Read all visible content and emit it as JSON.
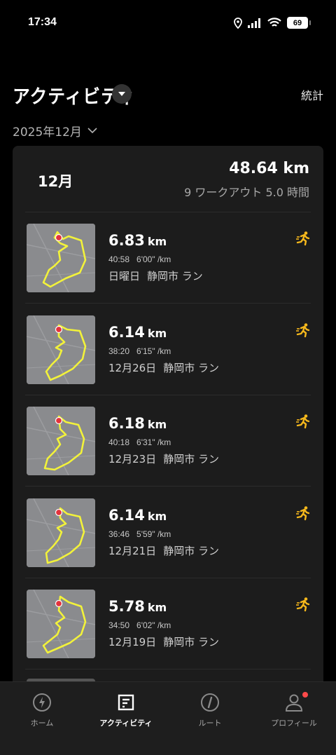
{
  "status_bar": {
    "time": "17:34",
    "battery": "69",
    "icons": [
      "location-icon",
      "signal-icon",
      "wifi-icon",
      "battery-icon"
    ]
  },
  "header": {
    "title": "アクティビティ",
    "stats_label": "統計"
  },
  "month_selector": {
    "label": "2025年12月"
  },
  "summary": {
    "month": "12月",
    "distance": "48.64 km",
    "sub": "9 ワークアウト  5.0 時間"
  },
  "activities": [
    {
      "distance": "6.83",
      "unit": "km",
      "duration": "40:58",
      "pace": "6'00\" /km",
      "day": "日曜日",
      "place": "静岡市 ラン"
    },
    {
      "distance": "6.14",
      "unit": "km",
      "duration": "38:20",
      "pace": "6'15\" /km",
      "day": "12月26日",
      "place": "静岡市 ラン"
    },
    {
      "distance": "6.18",
      "unit": "km",
      "duration": "40:18",
      "pace": "6'31\" /km",
      "day": "12月23日",
      "place": "静岡市 ラン"
    },
    {
      "distance": "6.14",
      "unit": "km",
      "duration": "36:46",
      "pace": "5'59\" /km",
      "day": "12月21日",
      "place": "静岡市 ラン"
    },
    {
      "distance": "5.78",
      "unit": "km",
      "duration": "34:50",
      "pace": "6'02\" /km",
      "day": "12月19日",
      "place": "静岡市 ラン"
    }
  ],
  "tabs": [
    {
      "label": "ホーム",
      "icon": "bolt-icon"
    },
    {
      "label": "アクティビティ",
      "icon": "activity-icon",
      "active": true
    },
    {
      "label": "ルート",
      "icon": "compass-icon"
    },
    {
      "label": "プロフィール",
      "icon": "profile-icon",
      "notification": true
    }
  ],
  "colors": {
    "accent_yellow": "#f2f23a",
    "run_icon": "#f5b81c",
    "notification": "#ff4a4a"
  }
}
